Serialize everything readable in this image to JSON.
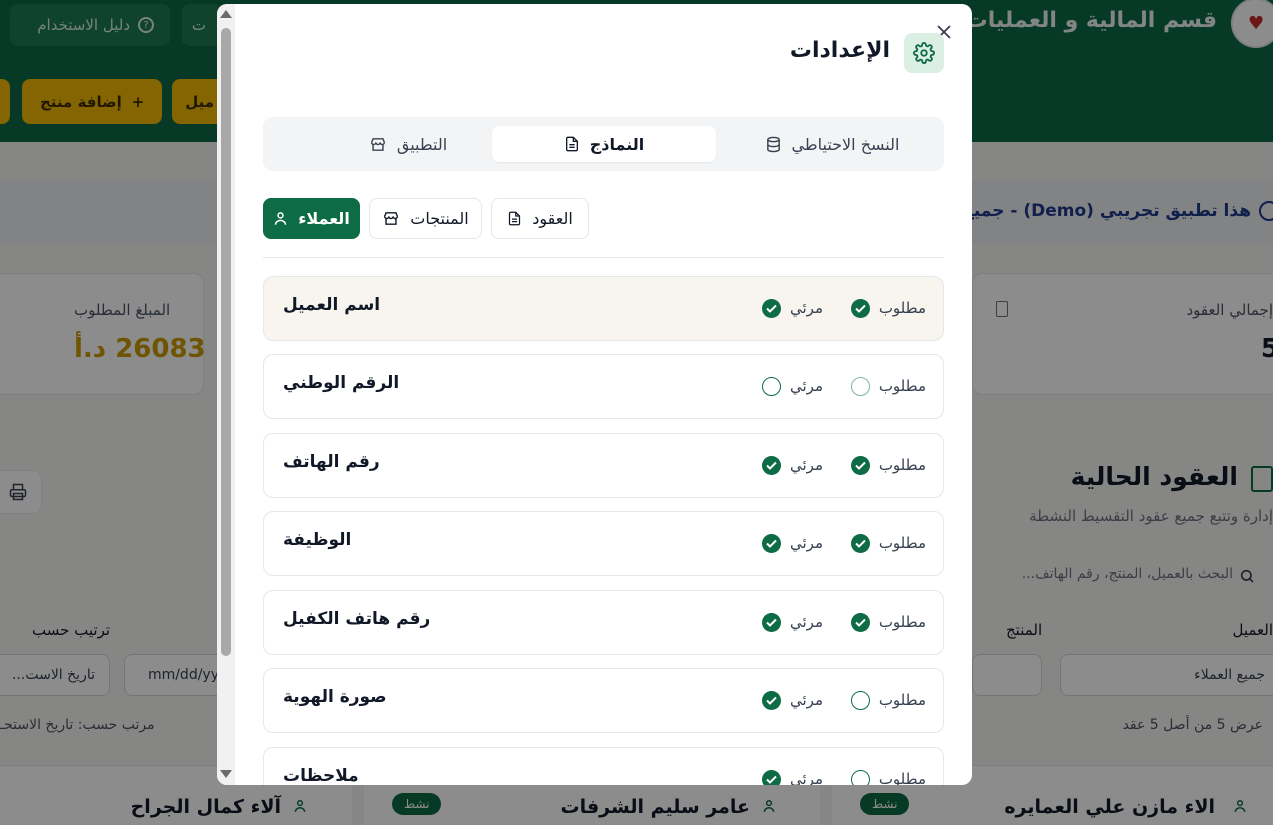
{
  "background": {
    "header": {
      "title": "قسم المالية و العمليات",
      "guide_label": "دليل الاستخدام",
      "cut_btn_label": "ت",
      "add_product_label": "إضافة منتج",
      "add_client_label": "ميل"
    },
    "demo_notice": "هذا تطبيق تجريبي (Demo) - جميع البيـ",
    "stats": {
      "total_contracts_label": "إجمالي العقود",
      "total_contracts_value": "5",
      "amount_due_label": "المبلغ المطلوب",
      "amount_due_value": "26083 د.أ"
    },
    "contracts": {
      "title": "العقود الحالية",
      "subtitle": "إدارة وتتبع جميع عقود التقسيط النشطة",
      "search_placeholder": "البحث بالعميل، المنتج، رقم الهاتف...",
      "filter_client_label": "العميل",
      "filter_client_value": "جميع العملاء",
      "filter_product_label": "المنتج",
      "sort_label": "ترتيب حسب",
      "sort_value": "تاريخ الاست...",
      "date_placeholder": "mm/dd/yy",
      "count_text": "عرض 5 من أصل 5 عقد",
      "sorted_by_text": "مرتب حسب: تاريخ الاستحـ",
      "cards": [
        {
          "name": "الاء مازن علي العمايره",
          "status": "نشط"
        },
        {
          "name": "عامر سليم الشرفات",
          "status": "نشط"
        },
        {
          "name": "آلاء كمال الجراح"
        }
      ]
    }
  },
  "modal": {
    "title": "الإعدادات",
    "tabs": [
      {
        "label": "النسخ الاحتياطي",
        "icon": "database-icon"
      },
      {
        "label": "النماذج",
        "icon": "document-icon",
        "active": true
      },
      {
        "label": "التطبيق",
        "icon": "store-icon"
      }
    ],
    "subtabs": [
      {
        "label": "العقود",
        "icon": "document-icon"
      },
      {
        "label": "المنتجات",
        "icon": "store-icon"
      },
      {
        "label": "العملاء",
        "icon": "user-icon",
        "active": true
      }
    ],
    "required_label": "مطلوب",
    "visible_label": "مرئي",
    "fields": [
      {
        "name": "اسم العميل",
        "required": true,
        "visible": true
      },
      {
        "name": "الرقم الوطني",
        "required": false,
        "visible": false
      },
      {
        "name": "رقم الهاتف",
        "required": true,
        "visible": true
      },
      {
        "name": "الوظيفة",
        "required": true,
        "visible": true
      },
      {
        "name": "رقم هاتف الكفيل",
        "required": true,
        "visible": true
      },
      {
        "name": "صورة الهوية",
        "required": false,
        "visible": true
      },
      {
        "name": "ملاحظات",
        "required": false,
        "visible": true
      }
    ],
    "colors": {
      "primary": "#0d6b45",
      "accent": "#f2b705",
      "highlight_row": "#f8f5ef"
    }
  }
}
